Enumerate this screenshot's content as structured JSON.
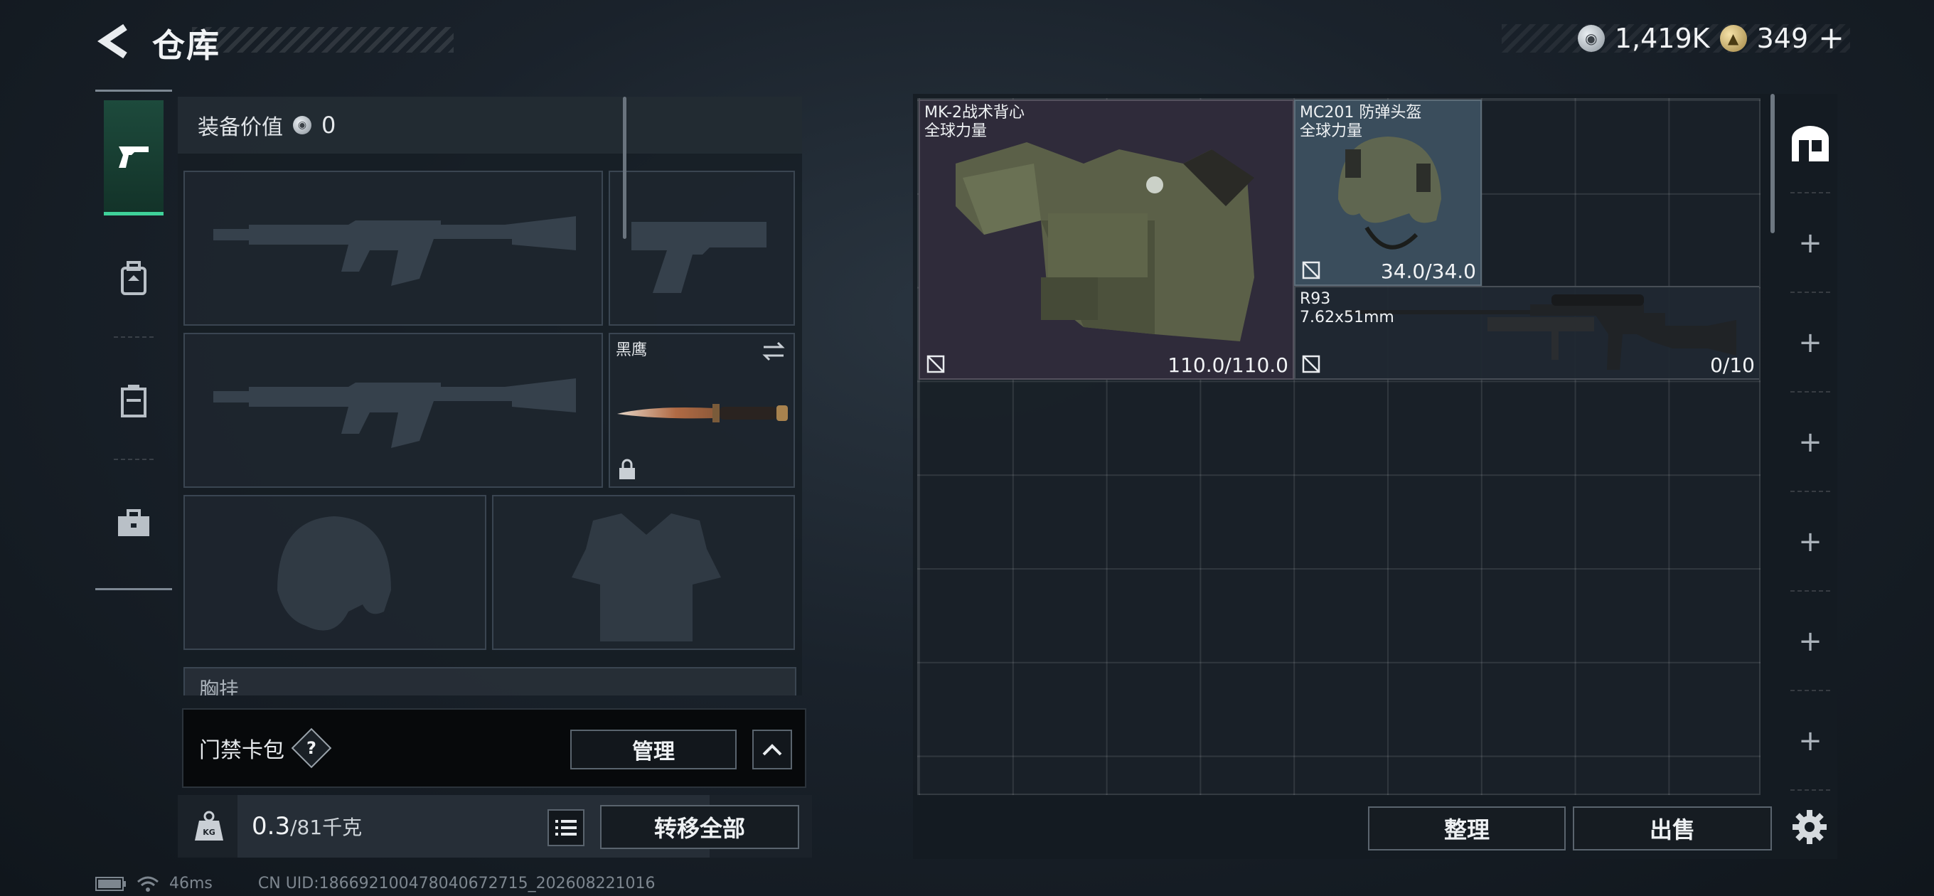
{
  "header": {
    "title": "仓库",
    "currency": [
      {
        "icon": "silver-coin-icon",
        "value": "1,419K"
      },
      {
        "icon": "gold-coin-icon",
        "value": "349"
      }
    ],
    "add_label": "+"
  },
  "left_rail": {
    "tabs": [
      {
        "icon": "pistol-icon",
        "active": true
      },
      {
        "icon": "backpack-icon",
        "active": false
      },
      {
        "icon": "clipboard-icon",
        "active": false
      },
      {
        "icon": "briefcase-icon",
        "active": false
      }
    ]
  },
  "equipment": {
    "label": "装备价值",
    "value": "0",
    "melee_slot_name": "黑鹰",
    "chest_rig_label": "胸挂"
  },
  "card_pack": {
    "label": "门禁卡包",
    "help": "?",
    "manage_label": "管理"
  },
  "capacity": {
    "current": "0.3",
    "max": "/81千克",
    "kg_label": "KG",
    "transfer_label": "转移全部"
  },
  "status": {
    "ping": "46ms",
    "uid": "CN UID:186692100478040672715_202608221016"
  },
  "storage": {
    "items": [
      {
        "name": "MK-2战术背心",
        "sub": "全球力量",
        "durability": "110.0/110.0"
      },
      {
        "name": "MC201 防弹头盔",
        "sub": "全球力量",
        "durability": "34.0/34.0"
      },
      {
        "name": "R93",
        "sub": "7.62x51mm",
        "durability": "0/10"
      }
    ],
    "side_slots": [
      "+",
      "+",
      "+",
      "+",
      "+",
      "+",
      "+"
    ],
    "sort_label": "整理",
    "sell_label": "出售"
  },
  "colors": {
    "accent_green": "#3fd29a",
    "vest_bg": "#3a3448",
    "helmet_bg": "#3b4f5f"
  }
}
